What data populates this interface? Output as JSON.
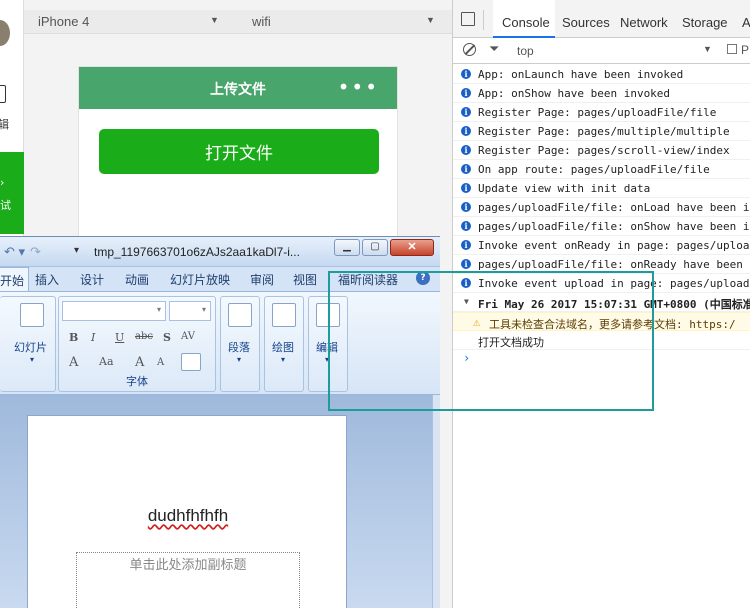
{
  "simulator": {
    "editor_label": "辑",
    "debug_label": "试",
    "device": "iPhone 4",
    "network": "wifi"
  },
  "phone": {
    "nav_title": "上传文件",
    "more": "•••",
    "open_button": "打开文件"
  },
  "devtools": {
    "tabs": [
      "Console",
      "Sources",
      "Network",
      "Storage",
      "Ap"
    ],
    "context": "top",
    "preserve_label": "P",
    "logs": [
      {
        "type": "info",
        "text": "App: onLaunch have been invoked"
      },
      {
        "type": "info",
        "text": "App: onShow have been invoked"
      },
      {
        "type": "info",
        "text": "Register Page: pages/uploadFile/file"
      },
      {
        "type": "info",
        "text": "Register Page: pages/multiple/multiple"
      },
      {
        "type": "info",
        "text": "Register Page: pages/scroll-view/index"
      },
      {
        "type": "info",
        "text": "On app route: pages/uploadFile/file"
      },
      {
        "type": "info",
        "text": "Update view with init data"
      },
      {
        "type": "info",
        "text": "pages/uploadFile/file: onLoad have been in"
      },
      {
        "type": "info",
        "text": "pages/uploadFile/file: onShow have been in"
      },
      {
        "type": "info",
        "text": "Invoke event onReady in page: pages/upload"
      },
      {
        "type": "info",
        "text": "pages/uploadFile/file: onReady have been i"
      },
      {
        "type": "info",
        "text": "Invoke event upload in page: pages/uploadF"
      },
      {
        "type": "group",
        "text": "Fri May 26 2017 15:07:31 GMT+0800 (中国标准"
      },
      {
        "type": "warn",
        "text": "工具未检查合法域名，更多请参考文档: https:/"
      },
      {
        "type": "plain",
        "text": "打开文档成功"
      }
    ],
    "prompt": "›"
  },
  "ppt": {
    "file_name": "tmp_1197663701o6zAJs2aa1kaDl7-i...",
    "tabs": {
      "home": "开始",
      "insert": "插入",
      "design": "设计",
      "animation": "动画",
      "slideshow": "幻灯片放映",
      "review": "审阅",
      "view": "视图",
      "foxit": "福昕阅读器"
    },
    "groups": {
      "slides": "幻灯片",
      "font": "字体",
      "paragraph": "段落",
      "drawing": "绘图",
      "editing": "编辑"
    },
    "font_buttons": {
      "bold": "B",
      "italic": "I",
      "underline": "U",
      "strike": "abc",
      "shadow": "S",
      "spacing": "AV",
      "grow": "A",
      "shrink": "A",
      "case": "Aa"
    },
    "slide_title": "dudhfhfhfh",
    "slide_subtitle": "单击此处添加副标题"
  },
  "colors": {
    "wechat_green": "#1aad19",
    "nav_green": "#48a56c",
    "highlight": "#1e9b9b"
  }
}
